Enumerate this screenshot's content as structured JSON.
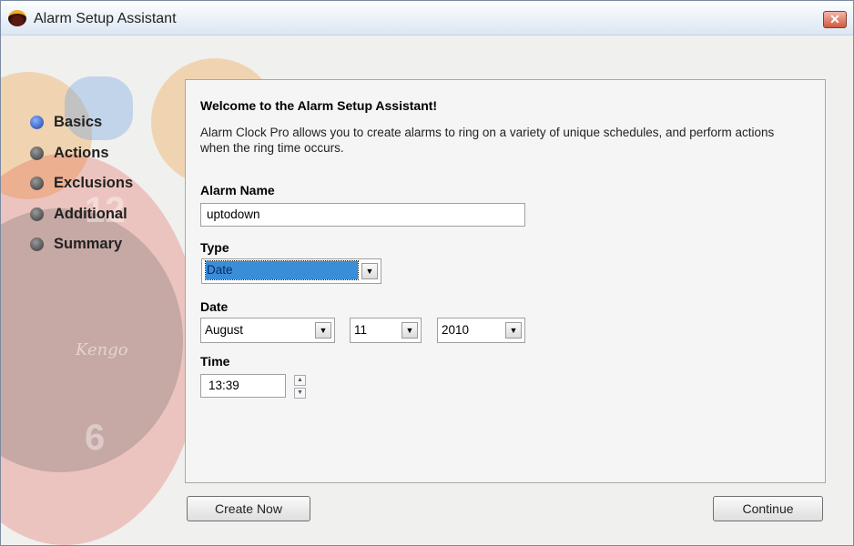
{
  "window": {
    "title": "Alarm Setup Assistant",
    "close_label": "✕"
  },
  "background": {
    "watermark": "Kengo",
    "numeral_top": "12",
    "numeral_bottom": "6"
  },
  "steps": [
    {
      "label": "Basics",
      "active": true
    },
    {
      "label": "Actions"
    },
    {
      "label": "Exclusions"
    },
    {
      "label": "Additional"
    },
    {
      "label": "Summary"
    }
  ],
  "panel": {
    "heading": "Welcome to the Alarm Setup Assistant!",
    "intro": "Alarm Clock Pro allows you to create alarms to ring on a variety of unique schedules, and perform actions when the ring time occurs.",
    "alarm_name_label": "Alarm Name",
    "alarm_name_value": "uptodown",
    "type_label": "Type",
    "type_value": "Date",
    "date_label": "Date",
    "month_value": "August",
    "day_value": "11",
    "year_value": "2010",
    "time_label": "Time",
    "time_value": "13:39"
  },
  "buttons": {
    "create_now": "Create Now",
    "continue": "Continue"
  }
}
